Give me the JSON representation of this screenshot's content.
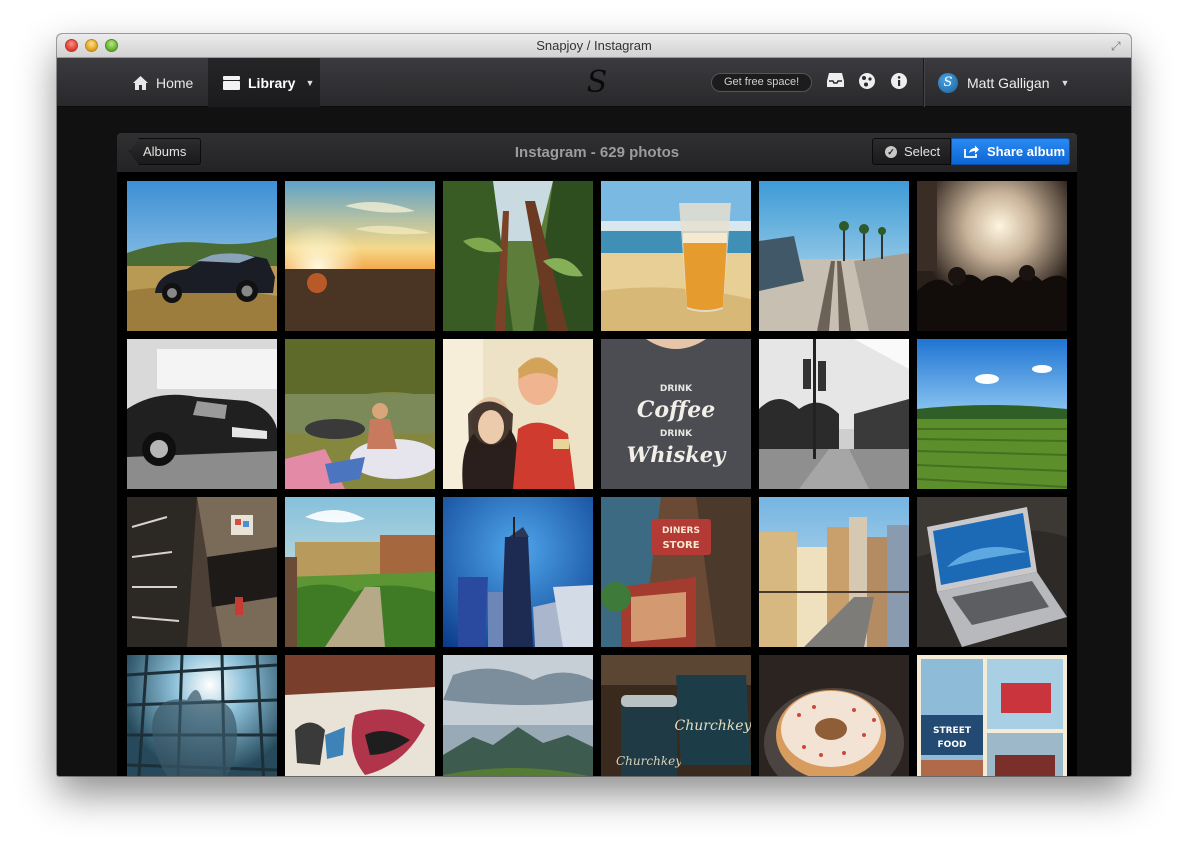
{
  "window": {
    "title": "Snapjoy / Instagram"
  },
  "nav": {
    "home_label": "Home",
    "library_label": "Library",
    "logo_glyph": "S",
    "free_space_label": "Get free space!",
    "icons": [
      "inbox-icon",
      "globe-icon",
      "info-icon"
    ],
    "user_name": "Matt Galligan",
    "avatar_glyph": "S"
  },
  "album": {
    "back_label": "Albums",
    "title": "Instagram - 629 photos",
    "select_label": "Select",
    "share_label": "Share album",
    "accent_color": "#1576e8"
  },
  "photos": [
    "car-in-field",
    "sunset-field",
    "redwood-trees",
    "beer-on-beach",
    "railway-pier",
    "concert-crowd",
    "car-black-white",
    "river-rafting",
    "couple-portrait",
    "drink-coffee-shirt",
    "street-lamps",
    "green-crop-field",
    "fire-escape-alley",
    "high-line-park",
    "tower-construction",
    "store-sign-street",
    "city-skyline",
    "macbook-laptop",
    "apple-logo-glass",
    "graffiti-wall",
    "mountain-landscape",
    "churchkey-cans",
    "frosted-donut",
    "streetfood-collage"
  ]
}
